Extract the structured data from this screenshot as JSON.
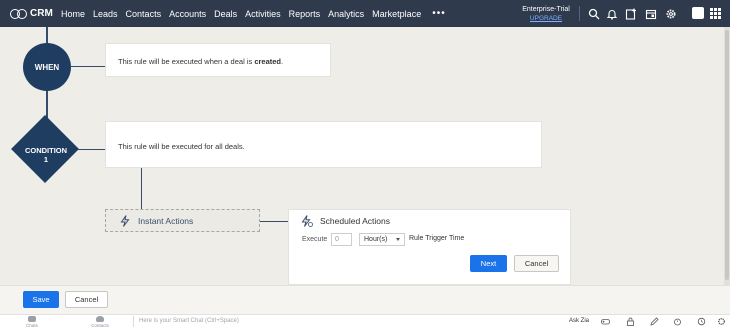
{
  "topbar": {
    "brand": "CRM",
    "nav": [
      "Home",
      "Leads",
      "Contacts",
      "Accounts",
      "Deals",
      "Activities",
      "Reports",
      "Analytics",
      "Marketplace"
    ],
    "more": "•••",
    "edition": "Enterprise-Trial",
    "upgrade": "UPGRADE",
    "icons": [
      "search-icon",
      "bell-icon",
      "new-entry-icon",
      "calendar-icon",
      "settings-icon",
      "avatar",
      "app-grid-icon"
    ]
  },
  "flow": {
    "when_label": "WHEN",
    "when_text_pre": "This rule will be executed when a deal is ",
    "when_text_bold": "created",
    "when_text_post": ".",
    "condition_label_1": "CONDITION",
    "condition_label_2": "1",
    "condition_text": "This rule will be executed for all deals.",
    "instant_label": "Instant Actions",
    "scheduled": {
      "title": "Scheduled Actions",
      "execute_label": "Execute",
      "number_placeholder": "0",
      "unit_value": "Hour(s)",
      "trigger_label": "Rule Trigger Time",
      "next_label": "Next",
      "cancel_label": "Cancel"
    }
  },
  "footer": {
    "save_label": "Save",
    "cancel_label": "Cancel"
  },
  "bottombar": {
    "chats_label": "Chats",
    "contacts_label": "Contacts",
    "smart_chat_placeholder": "Here is your Smart Chat (Ctrl+Space)",
    "askzia_label": "Ask Zia"
  },
  "colors": {
    "topbar_bg": "#2f3a4d",
    "node_fill": "#1f3d61",
    "primary_button": "#1a73e8",
    "canvas_bg": "#efede8",
    "upgrade_link": "#7fb3ff"
  }
}
